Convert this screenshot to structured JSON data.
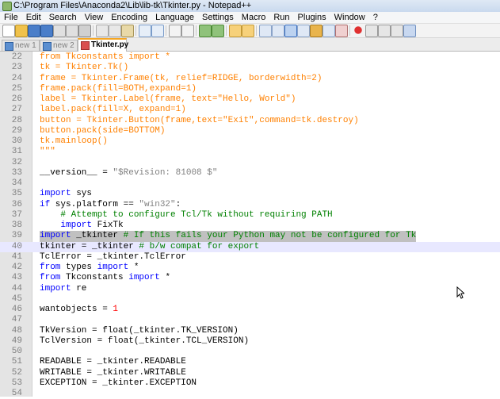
{
  "window": {
    "title": "C:\\Program Files\\Anaconda2\\Lib\\lib-tk\\Tkinter.py - Notepad++"
  },
  "menu": [
    "File",
    "Edit",
    "Search",
    "View",
    "Encoding",
    "Language",
    "Settings",
    "Macro",
    "Run",
    "Plugins",
    "Window",
    "?"
  ],
  "tabs": [
    {
      "label": "new 1",
      "active": false
    },
    {
      "label": "new 2",
      "active": false
    },
    {
      "label": "Tkinter.py",
      "active": true
    }
  ],
  "editor": {
    "lines": [
      {
        "num": "22",
        "text": "from Tkconstants import *",
        "style": "orange"
      },
      {
        "num": "23",
        "text": "tk = Tkinter.Tk()",
        "style": "orange"
      },
      {
        "num": "24",
        "text": "frame = Tkinter.Frame(tk, relief=RIDGE, borderwidth=2)",
        "style": "orange"
      },
      {
        "num": "25",
        "text": "frame.pack(fill=BOTH,expand=1)",
        "style": "orange"
      },
      {
        "num": "26",
        "text": "label = Tkinter.Label(frame, text=\"Hello, World\")",
        "style": "orange"
      },
      {
        "num": "27",
        "text": "label.pack(fill=X, expand=1)",
        "style": "orange"
      },
      {
        "num": "28",
        "text": "button = Tkinter.Button(frame,text=\"Exit\",command=tk.destroy)",
        "style": "orange"
      },
      {
        "num": "29",
        "text": "button.pack(side=BOTTOM)",
        "style": "orange"
      },
      {
        "num": "30",
        "text": "tk.mainloop()",
        "style": "orange"
      },
      {
        "num": "31",
        "text": "\"\"\"",
        "style": "orange"
      },
      {
        "num": "32",
        "text": "",
        "style": "plain"
      },
      {
        "num": "33",
        "text": "__version__ = \"$Revision: 81008 $\"",
        "style": "version"
      },
      {
        "num": "34",
        "text": "",
        "style": "plain"
      },
      {
        "num": "35",
        "text": "import sys",
        "style": "import"
      },
      {
        "num": "36",
        "text": "if sys.platform == \"win32\":",
        "style": "ifline"
      },
      {
        "num": "37",
        "text": "    # Attempt to configure Tcl/Tk without requiring PATH",
        "style": "comment"
      },
      {
        "num": "38",
        "text": "    import FixTk",
        "style": "import"
      },
      {
        "num": "39",
        "text": "import _tkinter # If this fails your Python may not be configured for Tk",
        "style": "hlimport"
      },
      {
        "num": "40",
        "text": "tkinter = _tkinter # b/w compat for export",
        "style": "curline"
      },
      {
        "num": "41",
        "text": "TclError = _tkinter.TclError",
        "style": "plain"
      },
      {
        "num": "42",
        "text": "from types import *",
        "style": "fromimp"
      },
      {
        "num": "43",
        "text": "from Tkconstants import *",
        "style": "fromimp"
      },
      {
        "num": "44",
        "text": "import re",
        "style": "import"
      },
      {
        "num": "45",
        "text": "",
        "style": "plain"
      },
      {
        "num": "46",
        "text": "wantobjects = 1",
        "style": "assignnum"
      },
      {
        "num": "47",
        "text": "",
        "style": "plain"
      },
      {
        "num": "48",
        "text": "TkVersion = float(_tkinter.TK_VERSION)",
        "style": "plain"
      },
      {
        "num": "49",
        "text": "TclVersion = float(_tkinter.TCL_VERSION)",
        "style": "plain"
      },
      {
        "num": "50",
        "text": "",
        "style": "plain"
      },
      {
        "num": "51",
        "text": "READABLE = _tkinter.READABLE",
        "style": "plain"
      },
      {
        "num": "52",
        "text": "WRITABLE = _tkinter.WRITABLE",
        "style": "plain"
      },
      {
        "num": "53",
        "text": "EXCEPTION = _tkinter.EXCEPTION",
        "style": "plain"
      },
      {
        "num": "54",
        "text": "",
        "style": "plain"
      }
    ]
  },
  "colors": {
    "string_orange": "#ff8000",
    "keyword_blue": "#0000ff",
    "comment_green": "#008000",
    "number_red": "#ff0000",
    "active_tab_accent": "#f5a623",
    "highlight_gray": "#c0c0c0"
  }
}
